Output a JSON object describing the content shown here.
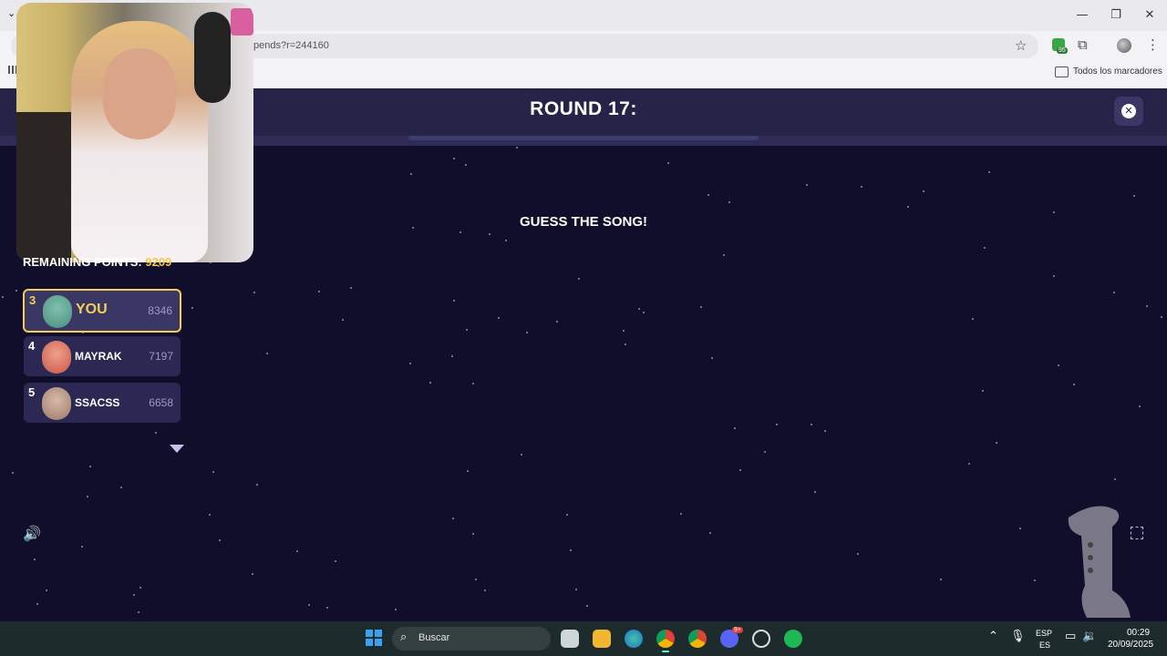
{
  "browser": {
    "url": "pends?r=244160",
    "bookmarks_label": "Todos los marcadores",
    "extension_badge": "95",
    "window_controls": {
      "minimize": "—",
      "maximize": "❐",
      "close": "✕"
    }
  },
  "game": {
    "round_title": "ROUND 17:",
    "prompt": "GUESS THE SONG!",
    "close_symbol": "✕",
    "remaining_points_label": "REMAINING POINTS:",
    "remaining_points_value": "9209",
    "leaderboard": [
      {
        "rank": "3",
        "name": "YOU",
        "score": "8346",
        "avatar_color": "#4a8f7a",
        "is_me": true
      },
      {
        "rank": "4",
        "name": "MAYRAK",
        "score": "7197",
        "avatar_color": "#c7564b",
        "is_me": false
      },
      {
        "rank": "5",
        "name": "SSACSS",
        "score": "6658",
        "avatar_color": "#9b7a6a",
        "is_me": false
      }
    ]
  },
  "taskbar": {
    "search_placeholder": "Buscar",
    "language": "ESP",
    "region": "ES",
    "time": "00:29",
    "date": "20/09/2025",
    "discord_badge": "9+"
  },
  "colors": {
    "background": "#110e2b",
    "header": "#262349",
    "accent_gold": "#f4cf57",
    "card": "#2b2854"
  }
}
